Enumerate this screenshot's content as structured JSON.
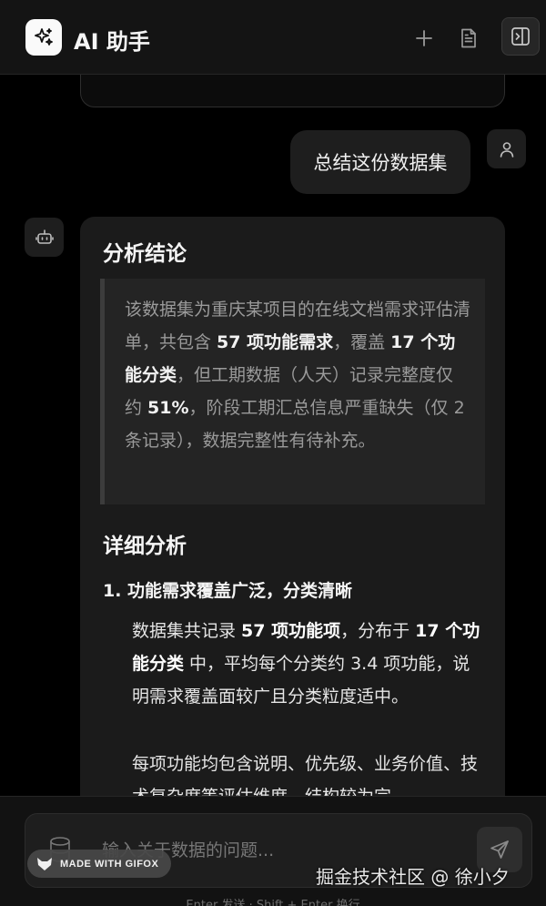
{
  "header": {
    "title": "AI 助手",
    "icons": [
      "sparkles-icon",
      "plus-icon",
      "document-icon",
      "panel-toggle-icon"
    ]
  },
  "chat": {
    "user_message": "总结这份数据集",
    "assistant": {
      "conclusion_heading": "分析结论",
      "summary": {
        "t1": "该数据集为重庆某项目的在线文档需求评估清单，共包含 ",
        "b1": "57 项功能需求",
        "t2": "，覆盖 ",
        "b2": "17 个功能分类",
        "t3": "，但工期数据（人天）记录完整度仅约 ",
        "b3": "51%",
        "t4": "，阶段工期汇总信息严重缺失（仅 2 条记录），数据完整性有待补充。"
      },
      "detail_heading": "详细分析",
      "item1_heading": "1. 功能需求覆盖广泛，分类清晰",
      "item1_para": {
        "t1": "数据集共记录 ",
        "b1": "57 项功能项",
        "t2": "，分布于 ",
        "b2": "17 个功能分类",
        "t3": " 中，平均每个分类约 3.4 项功能，说明需求覆盖面较广且分类粒度适中。"
      },
      "item1_para2": "每项功能均包含说明、优先级、业务价值、技术复杂度等评估维度，结构较为完"
    }
  },
  "input": {
    "placeholder": "输入关于数据的问题...",
    "hint": "Enter 发送 · Shift + Enter 换行"
  },
  "watermarks": {
    "gifox": "MADE WITH GIFOX",
    "juejin": "掘金技术社区 @ 徐小夕"
  }
}
